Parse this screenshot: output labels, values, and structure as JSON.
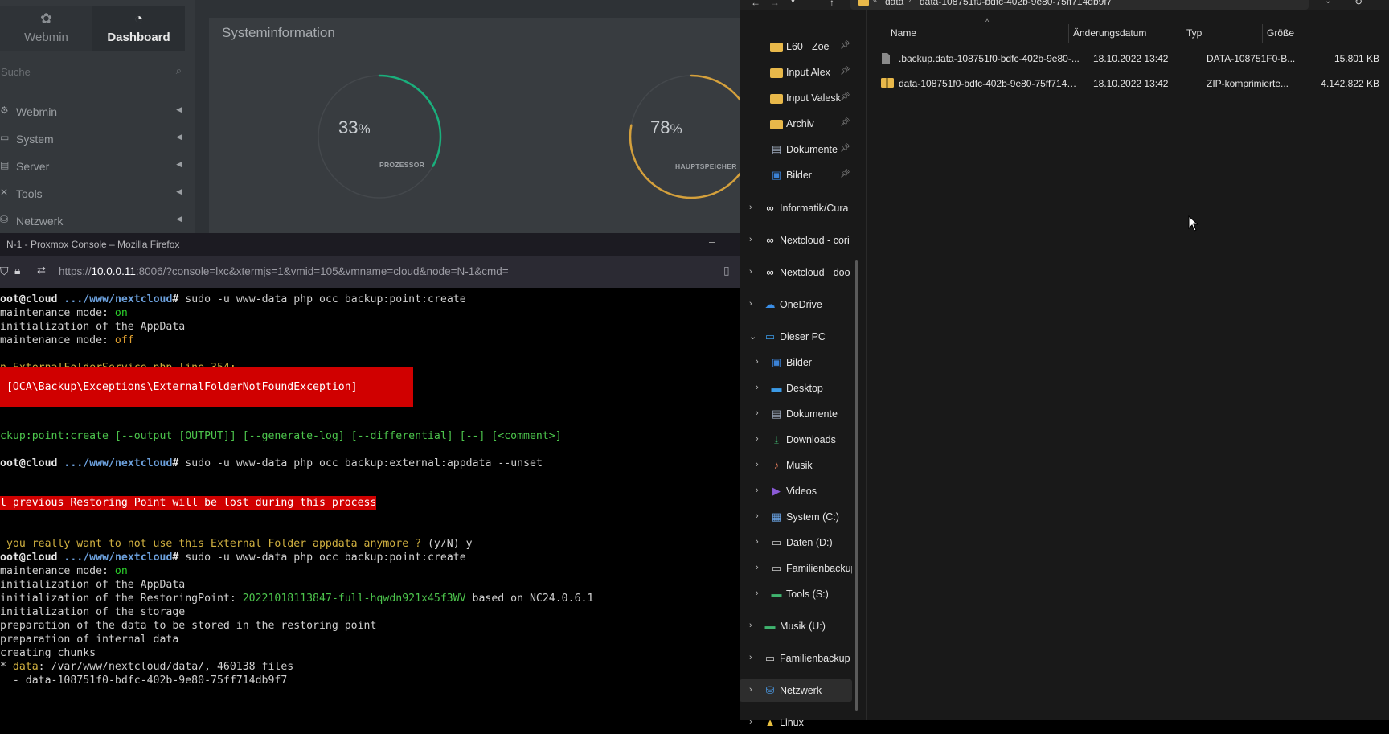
{
  "webmin": {
    "tabs": [
      {
        "label": "Webmin",
        "icon": "webmin-logo-icon"
      },
      {
        "label": "Dashboard",
        "icon": "dashboard-gauge-icon"
      }
    ],
    "search_placeholder": "Suche",
    "menu": [
      {
        "label": "Webmin",
        "icon": "gear-icon"
      },
      {
        "label": "System",
        "icon": "monitor-icon"
      },
      {
        "label": "Server",
        "icon": "server-icon"
      },
      {
        "label": "Tools",
        "icon": "wrench-icon"
      },
      {
        "label": "Netzwerk",
        "icon": "network-icon"
      }
    ],
    "panel_title": "Systeminformation",
    "gauges": [
      {
        "value": "33",
        "unit": "%",
        "label": "PROZESSOR",
        "fraction": 0.33,
        "color": "#1aaf7c"
      },
      {
        "value": "78",
        "unit": "%",
        "label": "HAUPTSPEICHER",
        "fraction": 0.78,
        "color": "#d4a03c"
      }
    ]
  },
  "firefox": {
    "title": "N-1 - Proxmox Console – Mozilla Firefox",
    "url_prefix": "https://",
    "url_host": "10.0.0.11",
    "url_rest": ":8006/?console=lxc&xtermjs=1&vmid=105&vmname=cloud&node=N-1&cmd=",
    "minimize": "–"
  },
  "terminal": {
    "prompt_user": "oot@cloud",
    "prompt_path": ".../www/nextcloud",
    "prompt_sign": "#",
    "cmd1": " sudo -u www-data php occ backup:point:create",
    "mm_label": "maintenance mode: ",
    "on": "on",
    "off": "off",
    "init_appdata": "initialization of the AppData",
    "in_file": "n ExternalFolderService.php line 354:",
    "exception": " [OCA\\Backup\\Exceptions\\ExternalFolderNotFoundException]",
    "usage": "ckup:point:create [--output [OUTPUT]] [--generate-log] [--differential] [--] [<comment>]",
    "cmd2": " sudo -u www-data php occ backup:external:appdata --unset",
    "warning": "l previous Restoring Point will be lost during this process",
    "question": " you really want to not use this External Folder appdata anymore ? ",
    "yn": "(y/N) y",
    "init_rp_label": "initialization of the RestoringPoint: ",
    "rp_id": "20221018113847-full-hqwdn921x45f3WV",
    "based_on": " based on NC24.0.6.1",
    "init_storage": "initialization of the storage",
    "prep_data": "preparation of the data to be stored in the restoring point",
    "prep_internal": "preparation of internal data",
    "creating": "creating chunks",
    "star": "* ",
    "data_label": "data",
    "data_path": ": /var/www/nextcloud/data/, 460138 files",
    "chunk": "  - data-108751f0-bdfc-402b-9e80-75ff714db9f7"
  },
  "explorer": {
    "breadcrumb": [
      "data",
      "data-108751f0-bdfc-402b-9e80-75ff714db9f7"
    ],
    "nav_items": [
      {
        "label": "L60 - Zoe",
        "icon": "folder-icon",
        "pinned": true
      },
      {
        "label": "Input Alex",
        "icon": "folder-icon",
        "pinned": true
      },
      {
        "label": "Input Valesk",
        "icon": "folder-icon",
        "pinned": true
      },
      {
        "label": "Archiv",
        "icon": "folder-icon",
        "pinned": true
      },
      {
        "label": "Dokumente",
        "icon": "documents-icon",
        "pinned": true
      },
      {
        "label": "Bilder",
        "icon": "pictures-icon",
        "pinned": true
      },
      {
        "label": "Informatik/Cura",
        "icon": "nextcloud-icon"
      },
      {
        "label": "Nextcloud - cori",
        "icon": "nextcloud-icon"
      },
      {
        "label": "Nextcloud - doo",
        "icon": "nextcloud-icon"
      },
      {
        "label": "OneDrive",
        "icon": "onedrive-icon"
      },
      {
        "label": "Dieser PC",
        "icon": "pc-icon"
      },
      {
        "label": "Bilder",
        "icon": "pictures-icon"
      },
      {
        "label": "Desktop",
        "icon": "desktop-icon"
      },
      {
        "label": "Dokumente",
        "icon": "documents-icon"
      },
      {
        "label": "Downloads",
        "icon": "download-icon"
      },
      {
        "label": "Musik",
        "icon": "music-icon"
      },
      {
        "label": "Videos",
        "icon": "videos-icon"
      },
      {
        "label": "System (C:)",
        "icon": "system-drive-icon"
      },
      {
        "label": "Daten (D:)",
        "icon": "drive-icon"
      },
      {
        "label": "Familienbackup",
        "icon": "drive-icon"
      },
      {
        "label": "Tools (S:)",
        "icon": "network-drive-icon"
      },
      {
        "label": "Musik (U:)",
        "icon": "network-drive-icon"
      },
      {
        "label": "Familienbackup",
        "icon": "drive-icon"
      },
      {
        "label": "Netzwerk",
        "icon": "network-icon"
      },
      {
        "label": "Linux",
        "icon": "linux-icon"
      }
    ],
    "columns": [
      "Name",
      "Änderungsdatum",
      "Typ",
      "Größe"
    ],
    "files": [
      {
        "name": ".backup.data-108751f0-bdfc-402b-9e80-...",
        "date": "18.10.2022 13:42",
        "type": "DATA-108751F0-B...",
        "size": "15.801 KB",
        "icon": "file-icon"
      },
      {
        "name": "data-108751f0-bdfc-402b-9e80-75ff714d...",
        "date": "18.10.2022 13:42",
        "type": "ZIP-komprimierte...",
        "size": "4.142.822 KB",
        "icon": "zip-folder-icon"
      }
    ]
  }
}
